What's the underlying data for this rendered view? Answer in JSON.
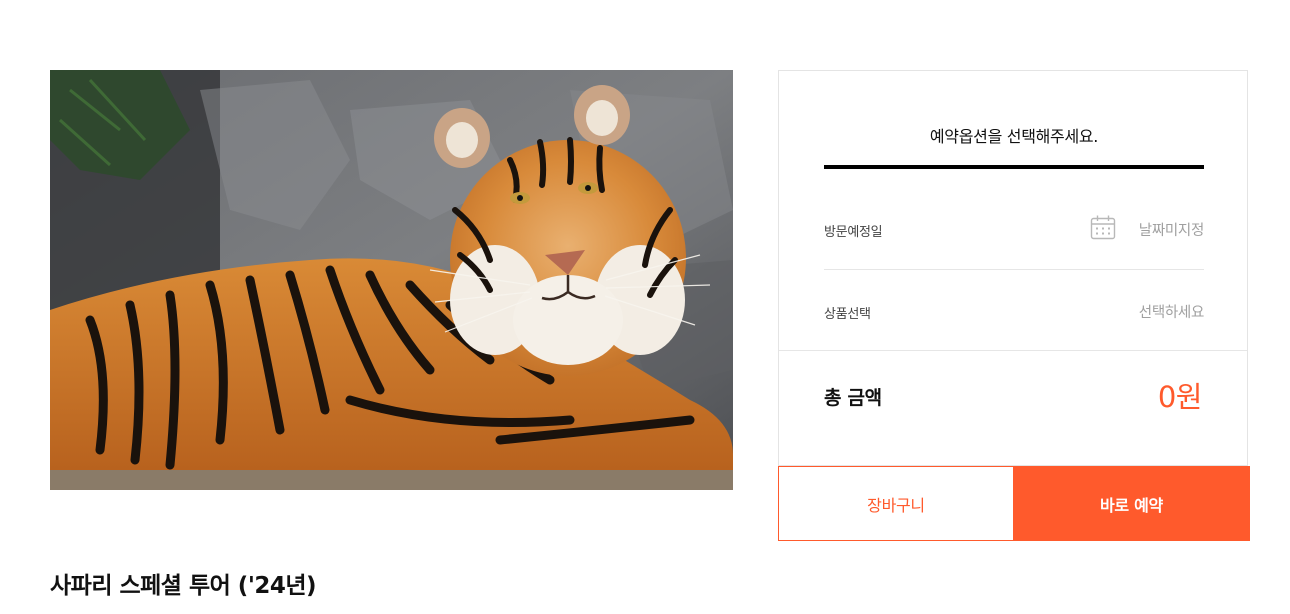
{
  "product": {
    "image_alt": "tiger photo",
    "title": "사파리 스페셜 투어 ('24년)"
  },
  "booking_panel": {
    "heading": "예약옵션을 선택해주세요.",
    "visit_date": {
      "label": "방문예정일",
      "value": "날짜미지정",
      "icon": "calendar-icon"
    },
    "product_select": {
      "label": "상품선택",
      "value": "선택하세요"
    },
    "total": {
      "label": "총 금액",
      "value": "0원"
    },
    "cart_button_label": "장바구니",
    "book_button_label": "바로 예약"
  },
  "colors": {
    "accent": "#ff5a2c",
    "divider": "#e6e6e6",
    "placeholder_text": "#a0a0a0"
  }
}
